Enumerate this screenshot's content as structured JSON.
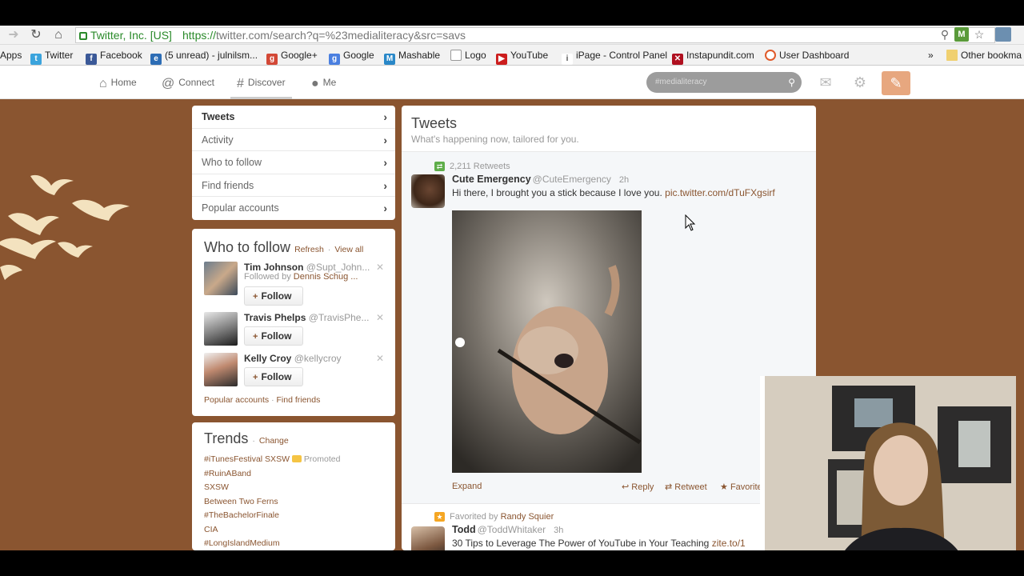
{
  "browser": {
    "ssl_label": "Twitter, Inc. [US]",
    "url_scheme": "https://",
    "url_rest": "twitter.com/search?q=%23medialiteracy&src=savs",
    "bookmarks": [
      {
        "label": "Apps",
        "icon": "apps-icon"
      },
      {
        "label": "Twitter",
        "icon": "twitter-bird-icon"
      },
      {
        "label": "Facebook",
        "icon": "facebook-icon"
      },
      {
        "label": "(5 unread) - julnilsm...",
        "icon": "mail-icon"
      },
      {
        "label": "Google+",
        "icon": "google-plus-icon"
      },
      {
        "label": "Google",
        "icon": "google-icon"
      },
      {
        "label": "Mashable",
        "icon": "mashable-icon"
      },
      {
        "label": "Logo",
        "icon": "page-icon"
      },
      {
        "label": "YouTube",
        "icon": "youtube-icon"
      },
      {
        "label": "iPage - Control Panel",
        "icon": "ipage-icon"
      },
      {
        "label": "Instapundit.com",
        "icon": "instapundit-icon"
      },
      {
        "label": "User Dashboard",
        "icon": "dashboard-icon"
      }
    ],
    "overflow_label": "»",
    "other_bookmarks": "Other bookma"
  },
  "twitter_nav": {
    "home": "Home",
    "connect": "Connect",
    "discover": "Discover",
    "me": "Me",
    "search_value": "#medialiteracy"
  },
  "discover_menu": [
    "Tweets",
    "Activity",
    "Who to follow",
    "Find friends",
    "Popular accounts"
  ],
  "who_to_follow": {
    "title": "Who to follow",
    "refresh": "Refresh",
    "view_all": "View all",
    "dot": "·",
    "follow_label": "Follow",
    "users": [
      {
        "name": "Tim Johnson",
        "handle": "@Supt_John...",
        "followed_by_prefix": "Followed by",
        "followed_by": "Dennis Schug ..."
      },
      {
        "name": "Travis Phelps",
        "handle": "@TravisPhe...",
        "followed_by_prefix": "",
        "followed_by": ""
      },
      {
        "name": "Kelly Croy",
        "handle": "@kellycroy",
        "followed_by_prefix": "",
        "followed_by": ""
      }
    ],
    "popular_accounts": "Popular accounts",
    "find_friends": "Find friends"
  },
  "trends": {
    "title": "Trends",
    "change": "Change",
    "promoted": "Promoted",
    "items": [
      "#iTunesFestival SXSW",
      "#RuinABand",
      "SXSW",
      "Between Two Ferns",
      "#TheBachelorFinale",
      "CIA",
      "#LongIslandMedium"
    ]
  },
  "stream": {
    "title": "Tweets",
    "subtitle": "What's happening now, tailored for you.",
    "tweets": [
      {
        "context": "2,211 Retweets",
        "name": "Cute Emergency",
        "handle": "@CuteEmergency",
        "time": "2h",
        "text": "Hi there, I brought you a stick because I love you.",
        "link": "pic.twitter.com/dTuFXgsirf",
        "expand": "Expand",
        "reply": "Reply",
        "retweet": "Retweet",
        "favorite": "Favorite"
      },
      {
        "context_prefix": "Favorited by",
        "context_user": "Randy Squier",
        "name": "Todd",
        "handle": "@ToddWhitaker",
        "time": "3h",
        "text": "30 Tips to Leverage The Power of YouTube in Your Teaching",
        "link": "zite.to/1"
      }
    ]
  },
  "colors": {
    "page_background": "#8a5530",
    "link": "#8a5530",
    "compose_button": "#e7a77f",
    "retweet_badge": "#5fae4a",
    "favorite_badge": "#f5a623"
  }
}
